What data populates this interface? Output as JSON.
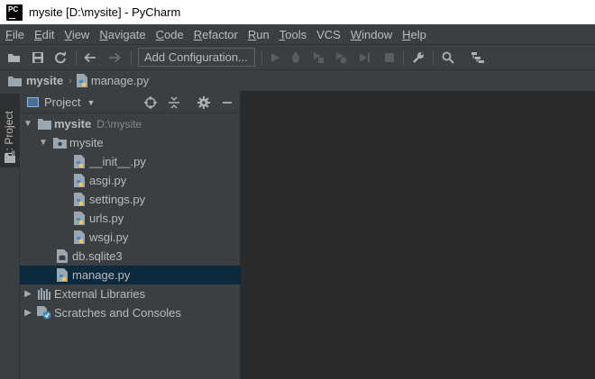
{
  "window": {
    "title": "mysite [D:\\mysite] - PyCharm",
    "logo_text": "PC"
  },
  "menu": [
    {
      "label": "File",
      "mnemonic": "F",
      "rest": "ile"
    },
    {
      "label": "Edit",
      "mnemonic": "E",
      "rest": "dit"
    },
    {
      "label": "View",
      "mnemonic": "V",
      "rest": "iew"
    },
    {
      "label": "Navigate",
      "mnemonic": "N",
      "rest": "avigate"
    },
    {
      "label": "Code",
      "mnemonic": "C",
      "rest": "ode"
    },
    {
      "label": "Refactor",
      "mnemonic": "R",
      "rest": "efactor"
    },
    {
      "label": "Run",
      "mnemonic": "R",
      "rest": "un"
    },
    {
      "label": "Tools",
      "mnemonic": "T",
      "rest": "ools"
    },
    {
      "label": "VCS",
      "mnemonic": "",
      "rest": "VCS"
    },
    {
      "label": "Window",
      "mnemonic": "W",
      "rest": "indow"
    },
    {
      "label": "Help",
      "mnemonic": "H",
      "rest": "elp"
    }
  ],
  "toolbar": {
    "add_configuration": "Add Configuration...",
    "icons": [
      "open-folder-icon",
      "save-icon",
      "sync-icon",
      "back-arrow-icon",
      "forward-arrow-icon",
      "run-icon",
      "debug-icon",
      "coverage-icon",
      "profile-icon",
      "concurrency-icon",
      "stop-icon",
      "wrench-icon",
      "search-icon",
      "structure-icon"
    ]
  },
  "navbar": {
    "project": "mysite",
    "file": "manage.py"
  },
  "left_strip": {
    "tab_number": "1",
    "tab_label": ": Project"
  },
  "project_panel": {
    "title": "Project",
    "tree": [
      {
        "label": "mysite",
        "path": "D:\\mysite",
        "type": "root"
      },
      {
        "label": "mysite",
        "type": "folder"
      },
      {
        "label": "__init__.py",
        "type": "py"
      },
      {
        "label": "asgi.py",
        "type": "py"
      },
      {
        "label": "settings.py",
        "type": "py"
      },
      {
        "label": "urls.py",
        "type": "py"
      },
      {
        "label": "wsgi.py",
        "type": "py"
      },
      {
        "label": "db.sqlite3",
        "type": "db"
      },
      {
        "label": "manage.py",
        "type": "py",
        "selected": true
      },
      {
        "label": "External Libraries",
        "type": "lib"
      },
      {
        "label": "Scratches and Consoles",
        "type": "scratch"
      }
    ]
  },
  "colors": {
    "selection": "#0d293e",
    "panel_bg": "#3c3f41",
    "editor_bg": "#2b2b2b",
    "text": "#bbbbbb"
  }
}
